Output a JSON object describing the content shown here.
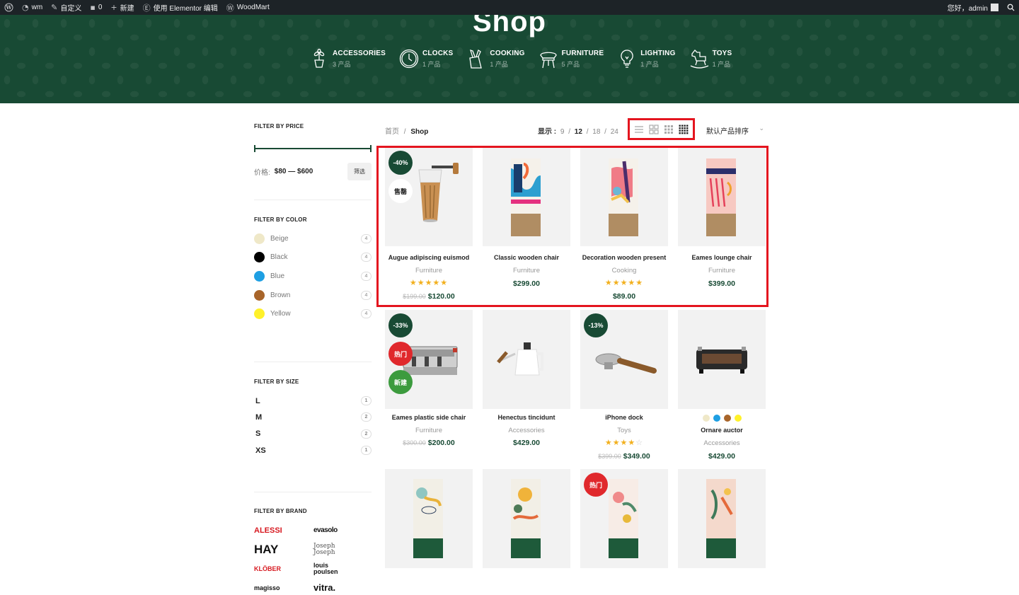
{
  "adminbar": {
    "items": [
      {
        "icon": "wordpress-icon",
        "label": ""
      },
      {
        "icon": "dashboard-icon",
        "label": "wm"
      },
      {
        "icon": "paintbrush-icon",
        "label": "自定义"
      },
      {
        "icon": "comment-icon",
        "label": "0"
      },
      {
        "icon": "plus-icon",
        "label": "新建"
      },
      {
        "icon": "elementor-icon",
        "label": "使用 Elementor 编辑"
      },
      {
        "icon": "woodmart-icon",
        "label": "WoodMart"
      }
    ],
    "greeting": "您好，admin",
    "search_icon": "search-icon"
  },
  "hero": {
    "title": "Shop",
    "bg_color": "#184a34",
    "categories": [
      {
        "name": "ACCESSORIES",
        "count": "3 产品",
        "icon": "plant-pot-icon"
      },
      {
        "name": "CLOCKS",
        "count": "1 产品",
        "icon": "clock-icon"
      },
      {
        "name": "COOKING",
        "count": "1 产品",
        "icon": "knife-block-icon"
      },
      {
        "name": "FURNITURE",
        "count": "5 产品",
        "icon": "chair-icon"
      },
      {
        "name": "LIGHTING",
        "count": "1 产品",
        "icon": "bulb-icon"
      },
      {
        "name": "TOYS",
        "count": "1 产品",
        "icon": "rocking-horse-icon"
      }
    ]
  },
  "filters": {
    "price": {
      "title": "FILTER BY PRICE",
      "label": "价格:",
      "range": "$80 — $600",
      "button": "筛选"
    },
    "color": {
      "title": "FILTER BY COLOR",
      "items": [
        {
          "name": "Beige",
          "count": "4",
          "color": "#efe8c8"
        },
        {
          "name": "Black",
          "count": "4",
          "color": "#000000"
        },
        {
          "name": "Blue",
          "count": "4",
          "color": "#1e9fe3"
        },
        {
          "name": "Brown",
          "count": "4",
          "color": "#a8652a"
        },
        {
          "name": "Yellow",
          "count": "4",
          "color": "#fff12a"
        }
      ]
    },
    "size": {
      "title": "FILTER BY SIZE",
      "items": [
        {
          "name": "L",
          "count": "1"
        },
        {
          "name": "M",
          "count": "2"
        },
        {
          "name": "S",
          "count": "2"
        },
        {
          "name": "XS",
          "count": "1"
        }
      ]
    },
    "brand": {
      "title": "FILTER BY BRAND",
      "items": [
        "ALESSI",
        "evasolo",
        "HAY",
        "Joseph Joseph",
        "KLÖBER",
        "louis poulsen",
        "magisso",
        "vitra."
      ]
    }
  },
  "toolbar": {
    "breadcrumb_home": "首页",
    "breadcrumb_sep": "/",
    "breadcrumb_current": "Shop",
    "show_label": "显示 :",
    "per_page": [
      "9",
      "12",
      "18",
      "24"
    ],
    "per_page_active": "12",
    "sort_label": "默认产品排序",
    "view_icons": [
      "list-view-icon",
      "grid-2-icon",
      "grid-3-icon",
      "grid-4-icon"
    ]
  },
  "products": [
    {
      "name": "Augue adipiscing euismod",
      "category": "Furniture",
      "stars": 5,
      "old_price": "$199.00",
      "price": "$120.00",
      "badges": [
        "-40%",
        "售罄"
      ]
    },
    {
      "name": "Classic wooden chair",
      "category": "Furniture",
      "stars": 0,
      "old_price": "",
      "price": "$299.00",
      "badges": []
    },
    {
      "name": "Decoration wooden present",
      "category": "Cooking",
      "stars": 5,
      "old_price": "",
      "price": "$89.00",
      "badges": []
    },
    {
      "name": "Eames lounge chair",
      "category": "Furniture",
      "stars": 0,
      "old_price": "",
      "price": "$399.00",
      "badges": []
    },
    {
      "name": "Eames plastic side chair",
      "category": "Furniture",
      "stars": 0,
      "old_price": "$300.00",
      "price": "$200.00",
      "badges": [
        "-33%",
        "热门",
        "新建"
      ]
    },
    {
      "name": "Henectus tincidunt",
      "category": "Accessories",
      "stars": 0,
      "old_price": "",
      "price": "$429.00",
      "badges": []
    },
    {
      "name": "iPhone dock",
      "category": "Toys",
      "stars": 4,
      "old_price": "$399.00",
      "price": "$349.00",
      "badges": [
        "-13%"
      ]
    },
    {
      "name": "Ornare auctor",
      "category": "Accessories",
      "stars": 0,
      "old_price": "",
      "price": "$429.00",
      "badges": [],
      "swatches": [
        "#efe8c8",
        "#1e9fe3",
        "#a8652a",
        "#fff12a"
      ]
    },
    {
      "name": "",
      "category": "",
      "stars": 0,
      "old_price": "",
      "price": "",
      "badges": []
    },
    {
      "name": "",
      "category": "",
      "stars": 0,
      "old_price": "",
      "price": "",
      "badges": []
    },
    {
      "name": "",
      "category": "",
      "stars": 0,
      "old_price": "",
      "price": "",
      "badges": [
        "热门"
      ]
    },
    {
      "name": "",
      "category": "",
      "stars": 0,
      "old_price": "",
      "price": "",
      "badges": []
    }
  ],
  "badge_colors": {
    "sale": "#184a34",
    "sold": "#ffffff",
    "hot": "#e0282c",
    "new": "#3c9b3e"
  }
}
